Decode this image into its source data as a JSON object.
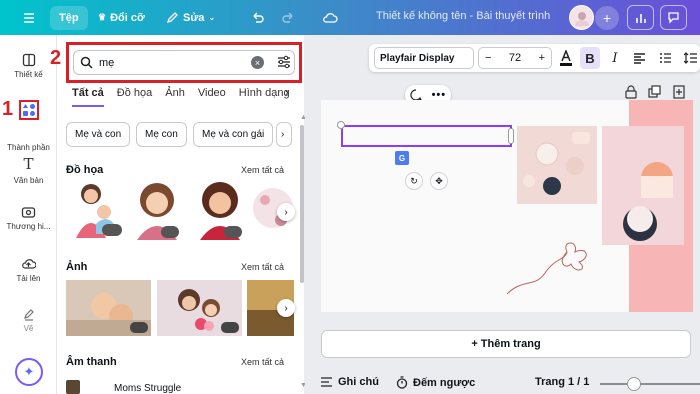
{
  "topbar": {
    "menu_icon": "hamburger-icon",
    "file_label": "Tệp",
    "resize_label": "Đổi cỡ",
    "edit_label": "Sửa",
    "doc_title": "Thiết kế không tên - Bài thuyết trình"
  },
  "rail": {
    "items": [
      {
        "label": "Thiết kế",
        "icon": "design-icon"
      },
      {
        "label": "Thành phần",
        "icon": "elements-icon"
      },
      {
        "label": "Văn bản",
        "icon": "text-icon"
      },
      {
        "label": "Thương hi...",
        "icon": "brand-icon"
      },
      {
        "label": "Tải lên",
        "icon": "upload-icon"
      },
      {
        "label": "Vẽ",
        "icon": "draw-icon"
      }
    ],
    "annotation_1": "1",
    "annotation_2": "2"
  },
  "search": {
    "value": "mẹ"
  },
  "tabs": [
    "Tất cả",
    "Đồ họa",
    "Ảnh",
    "Video",
    "Hình dạng"
  ],
  "chips": [
    "Mẹ và con",
    "Mẹ con",
    "Mẹ và con gái"
  ],
  "sections": {
    "graphics": {
      "title": "Đồ họa",
      "see_all": "Xem tất cả"
    },
    "photos": {
      "title": "Ảnh",
      "see_all": "Xem tất cả"
    },
    "audio": {
      "title": "Âm thanh",
      "see_all": "Xem tất cả",
      "first_track": "Moms Struggle"
    }
  },
  "toolbar": {
    "font": "Playfair Display",
    "size": "72",
    "minus": "−",
    "plus": "+",
    "bold": "B",
    "italic": "I"
  },
  "canvas": {
    "add_page_label": "+ Thêm trang"
  },
  "footer": {
    "notes_label": "Ghi chú",
    "timer_label": "Đếm ngược",
    "page_label": "Trang 1 / 1"
  },
  "colors": {
    "accent": "#8b3dff",
    "annotation_red": "#d92027",
    "pink_block": "#f8b5b5"
  }
}
